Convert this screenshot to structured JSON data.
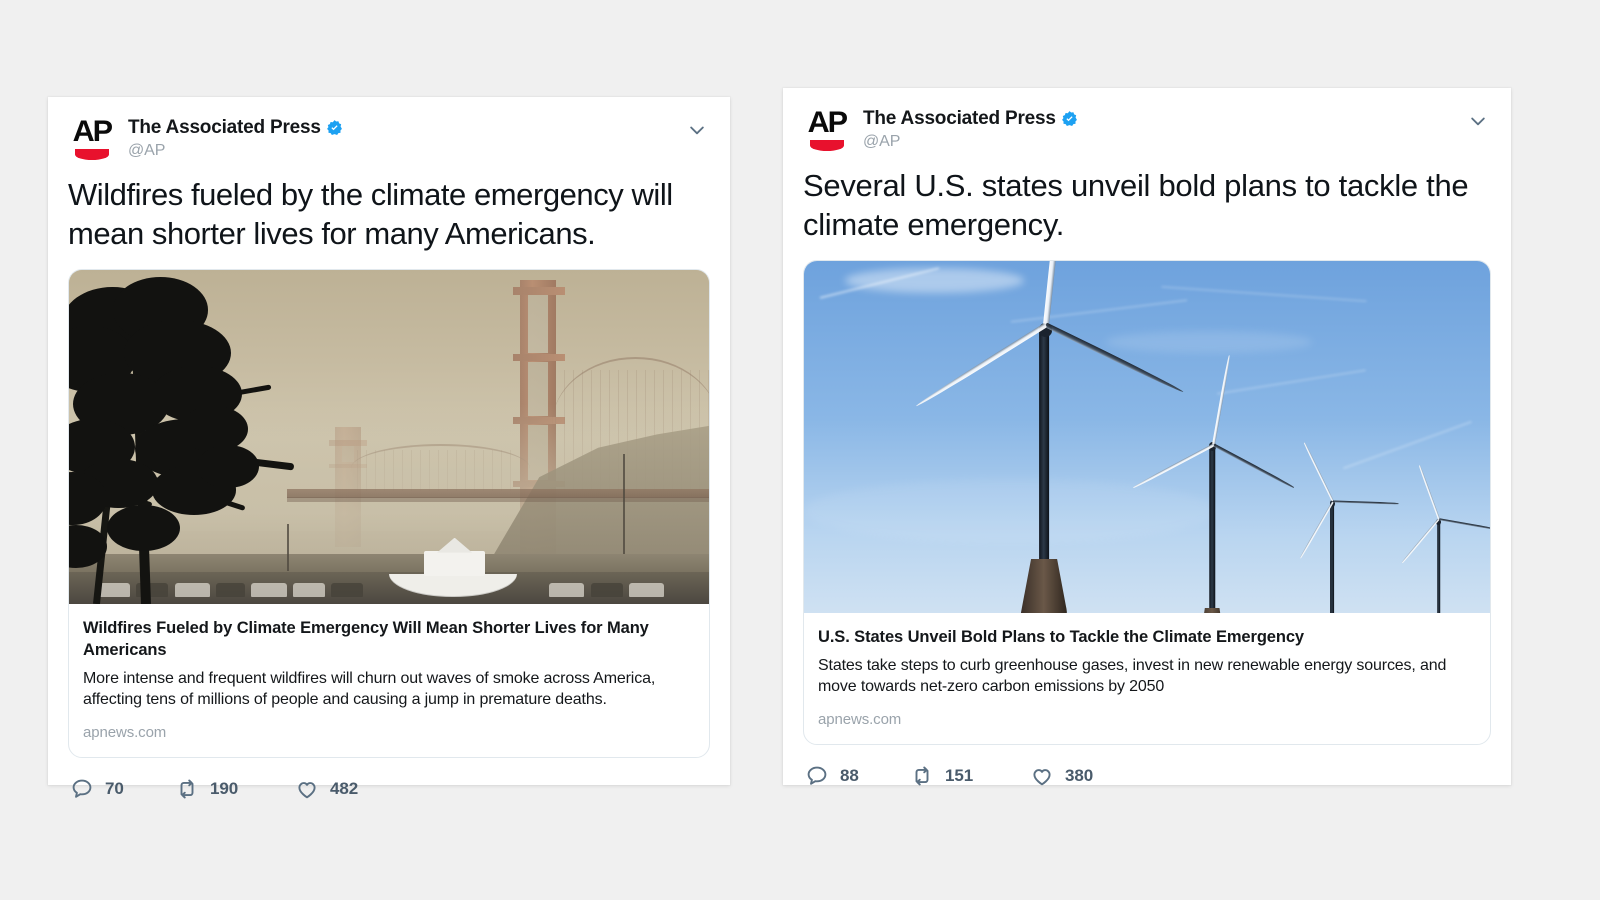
{
  "page": {
    "background_color": "#f0f0f0",
    "accent_verified_color": "#1DA1F2",
    "ap_red": "#e8112d"
  },
  "tweets": [
    {
      "id": "tweet-wildfires",
      "author": {
        "display_name": "The Associated Press",
        "handle": "@AP",
        "verified": true,
        "avatar_text": "AP"
      },
      "caret_icon": "chevron-down-icon",
      "text": "Wildfires fueled by the climate emergency will mean shorter lives for many Americans.",
      "link_card": {
        "image_alt": "Golden Gate Bridge shrouded in wildfire smoke",
        "title": "Wildfires Fueled by Climate Emergency Will Mean Shorter Lives for Many Americans",
        "description": "More intense and frequent wildfires will churn out waves of smoke across America, affecting tens of millions of people and causing a jump in premature deaths.",
        "domain": "apnews.com"
      },
      "actions": {
        "reply": {
          "icon": "reply-icon",
          "count": "70"
        },
        "retweet": {
          "icon": "retweet-icon",
          "count": "190"
        },
        "like": {
          "icon": "heart-icon",
          "count": "482"
        }
      }
    },
    {
      "id": "tweet-states",
      "author": {
        "display_name": "The Associated Press",
        "handle": "@AP",
        "verified": true,
        "avatar_text": "AP"
      },
      "caret_icon": "chevron-down-icon",
      "text": "Several U.S. states unveil bold plans to tackle the climate emergency.",
      "link_card": {
        "image_alt": "Row of wind turbines against a blue sky",
        "title": "U.S. States Unveil Bold Plans to Tackle the Climate Emergency",
        "description": "States take steps to curb greenhouse gases, invest in new renewable energy sources, and move towards net-zero carbon emissions by 2050",
        "domain": "apnews.com"
      },
      "actions": {
        "reply": {
          "icon": "reply-icon",
          "count": "88"
        },
        "retweet": {
          "icon": "retweet-icon",
          "count": "151"
        },
        "like": {
          "icon": "heart-icon",
          "count": "380"
        }
      }
    }
  ]
}
